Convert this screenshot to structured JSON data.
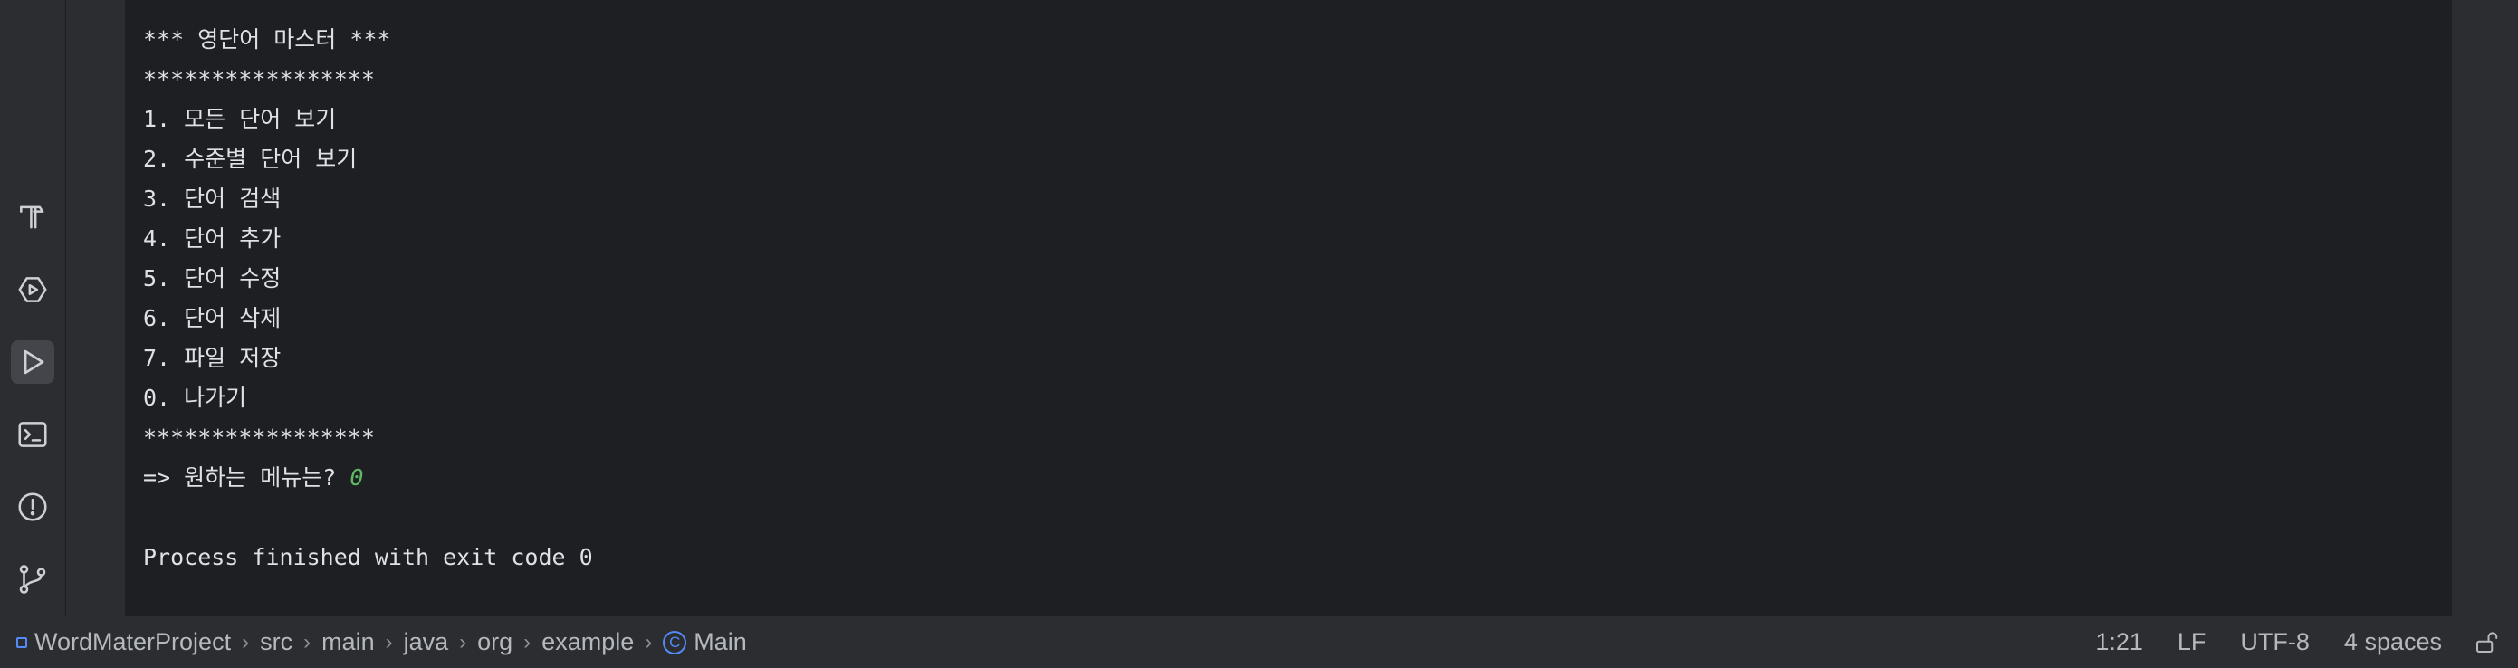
{
  "sidebar": {
    "icons": [
      {
        "name": "build-hammer-icon",
        "active": false
      },
      {
        "name": "services-icon",
        "active": false
      },
      {
        "name": "run-icon",
        "active": true
      },
      {
        "name": "terminal-icon",
        "active": false
      },
      {
        "name": "problems-icon",
        "active": false
      },
      {
        "name": "git-icon",
        "active": false
      }
    ]
  },
  "console": {
    "top_partial_line": "----------------------------------------",
    "lines": [
      "*** 영단어 마스터 ***",
      "*****************",
      "1. 모든 단어 보기",
      "2. 수준별 단어 보기",
      "3. 단어 검색",
      "4. 단어 추가",
      "5. 단어 수정",
      "6. 단어 삭제",
      "7. 파일 저장",
      "0. 나가기",
      "*****************"
    ],
    "prompt_text": "=> 원하는 메뉴는? ",
    "user_input": "0",
    "exit_message": "Process finished with exit code 0"
  },
  "statusbar": {
    "breadcrumbs": [
      "WordMaterProject",
      "src",
      "main",
      "java",
      "org",
      "example",
      "Main"
    ],
    "class_icon_letter": "C",
    "position": "1:21",
    "line_separator": "LF",
    "encoding": "UTF-8",
    "indent": "4 spaces"
  }
}
